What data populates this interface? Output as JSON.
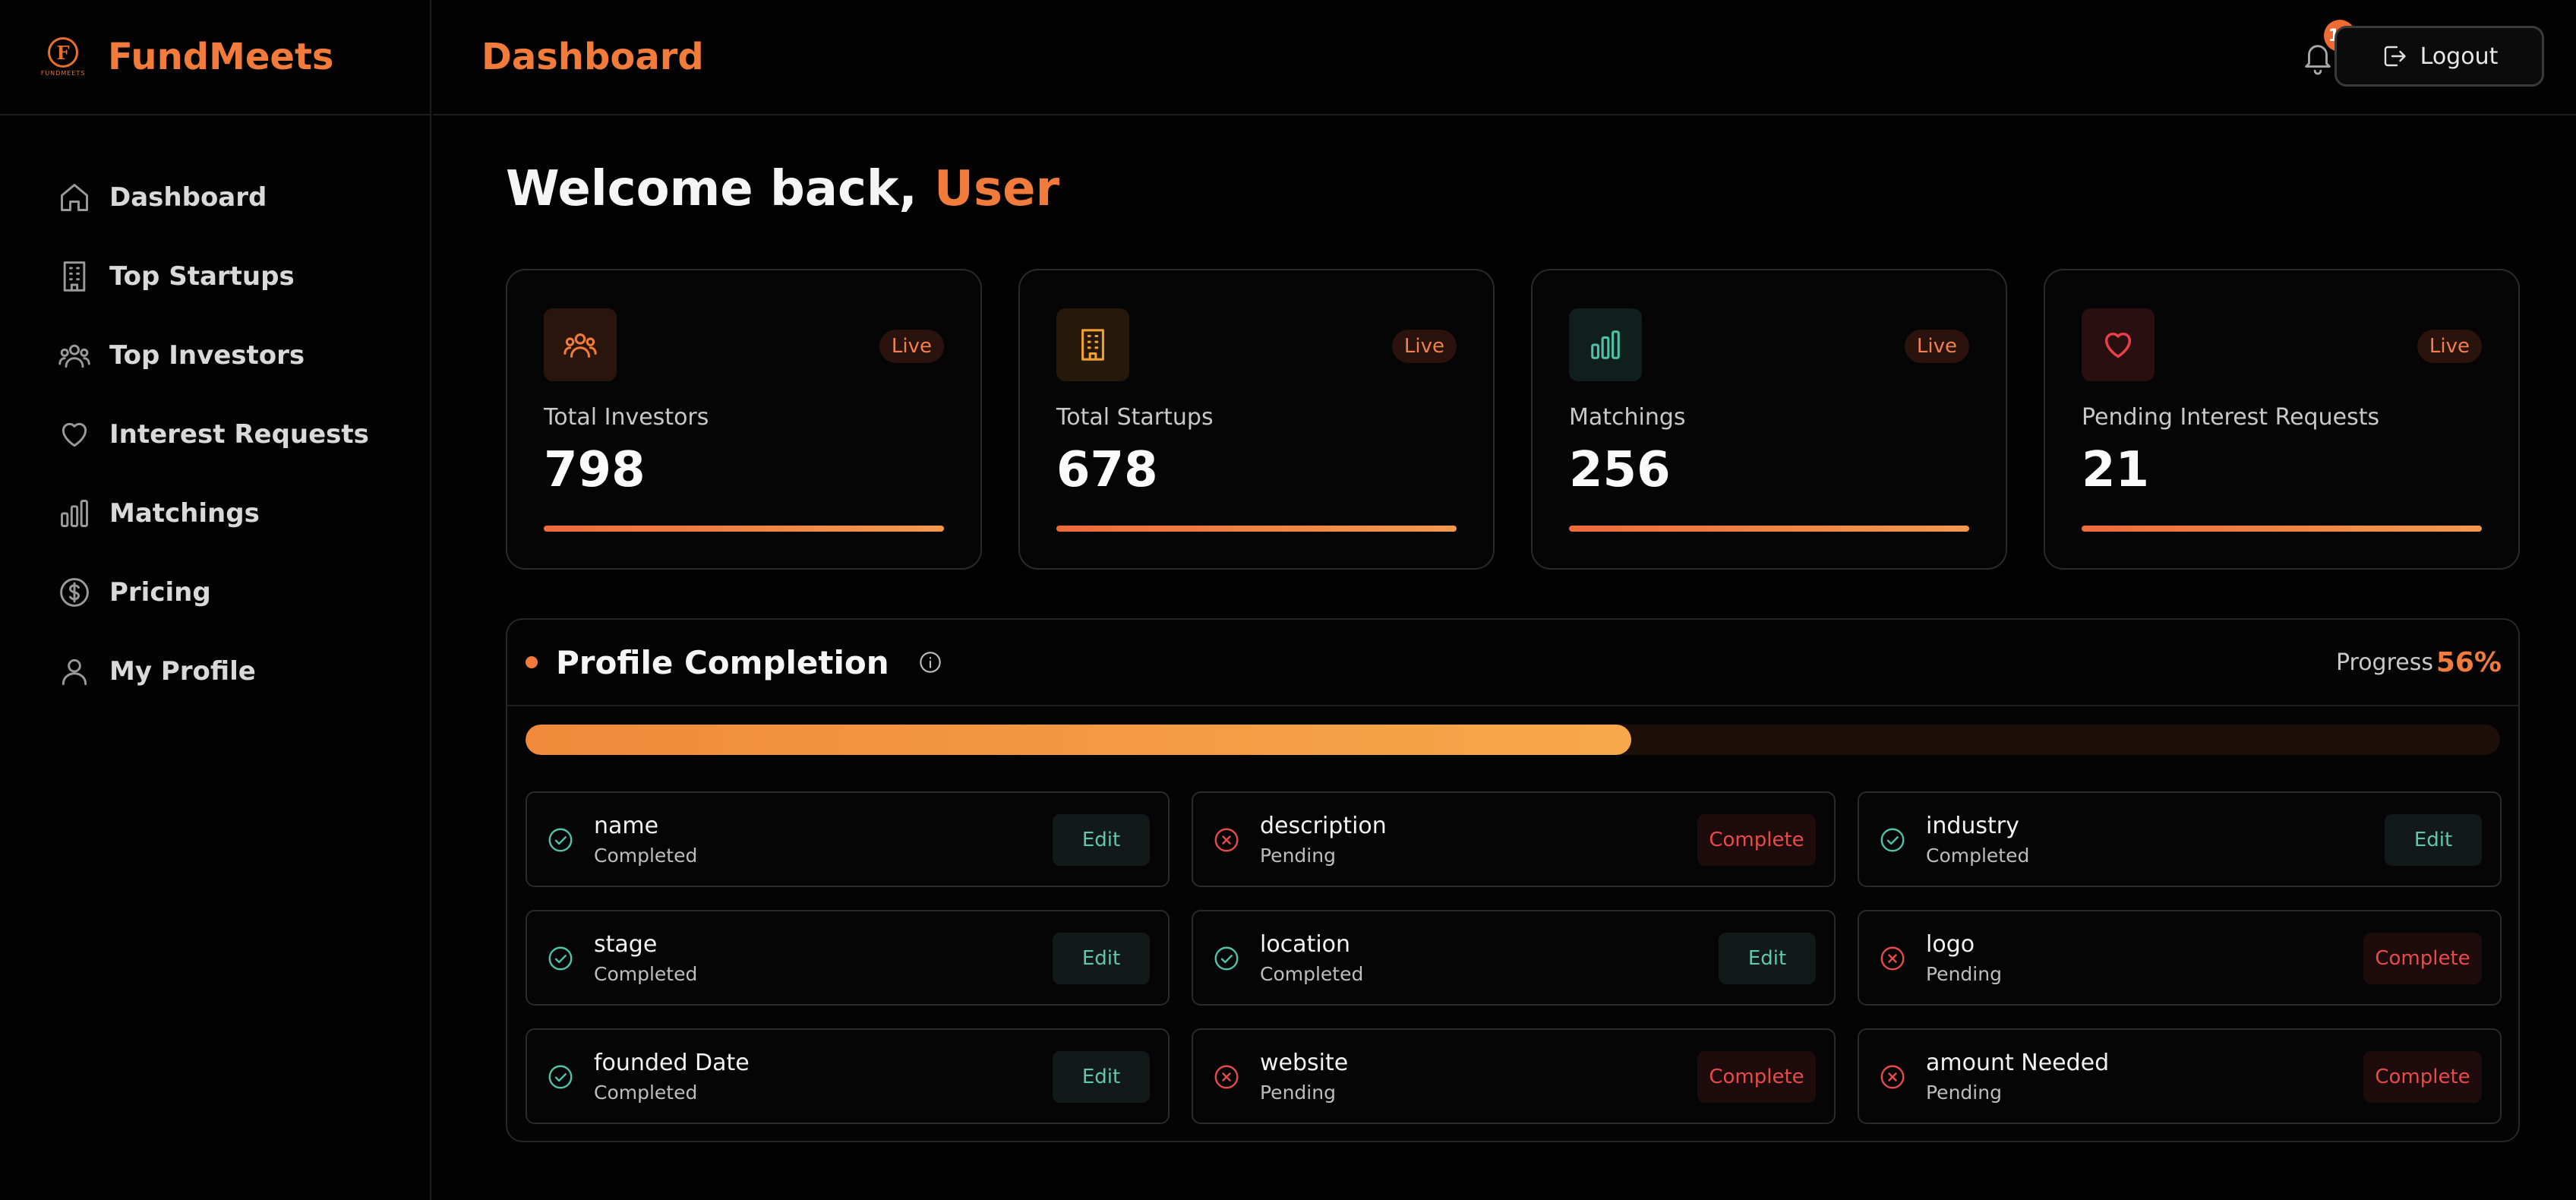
{
  "brand": {
    "name": "FundMeets",
    "logo_letter": "F",
    "logo_text": "FUNDMEETS"
  },
  "sidebar": {
    "items": [
      {
        "label": "Dashboard",
        "icon": "home-icon"
      },
      {
        "label": "Top Startups",
        "icon": "building-icon"
      },
      {
        "label": "Top Investors",
        "icon": "users-icon"
      },
      {
        "label": "Interest Requests",
        "icon": "heart-icon"
      },
      {
        "label": "Matchings",
        "icon": "bar-chart-icon"
      },
      {
        "label": "Pricing",
        "icon": "dollar-circle-icon"
      },
      {
        "label": "My Profile",
        "icon": "user-icon"
      }
    ]
  },
  "header": {
    "title": "Dashboard",
    "notification_count": "12",
    "logout_label": "Logout"
  },
  "welcome": {
    "prefix": "Welcome back, ",
    "user": "User"
  },
  "stats": [
    {
      "label": "Total Investors",
      "value": "798",
      "badge": "Live",
      "icon": "users-icon",
      "accent": "#f07b3a"
    },
    {
      "label": "Total Startups",
      "value": "678",
      "badge": "Live",
      "icon": "building-icon",
      "accent": "#f0a030"
    },
    {
      "label": "Matchings",
      "value": "256",
      "badge": "Live",
      "icon": "bar-chart-icon",
      "accent": "#4fc3a8"
    },
    {
      "label": "Pending Interest Requests",
      "value": "21",
      "badge": "Live",
      "icon": "heart-icon",
      "accent": "#e8404a"
    }
  ],
  "profile": {
    "title": "Profile Completion",
    "progress_label": "Progress",
    "progress_value": "56%",
    "progress_fraction": 0.56,
    "fields": [
      {
        "name": "name",
        "state": "Completed",
        "action": "Edit",
        "done": true
      },
      {
        "name": "description",
        "state": "Pending",
        "action": "Complete",
        "done": false
      },
      {
        "name": "industry",
        "state": "Completed",
        "action": "Edit",
        "done": true
      },
      {
        "name": "stage",
        "state": "Completed",
        "action": "Edit",
        "done": true
      },
      {
        "name": "location",
        "state": "Completed",
        "action": "Edit",
        "done": true
      },
      {
        "name": "logo",
        "state": "Pending",
        "action": "Complete",
        "done": false
      },
      {
        "name": "founded Date",
        "state": "Completed",
        "action": "Edit",
        "done": true
      },
      {
        "name": "website",
        "state": "Pending",
        "action": "Complete",
        "done": false
      },
      {
        "name": "amount Needed",
        "state": "Pending",
        "action": "Complete",
        "done": false
      }
    ]
  },
  "colors": {
    "accent": "#f07b3a",
    "success": "#4fc3a8",
    "danger": "#e84a4a",
    "background": "#020202"
  }
}
